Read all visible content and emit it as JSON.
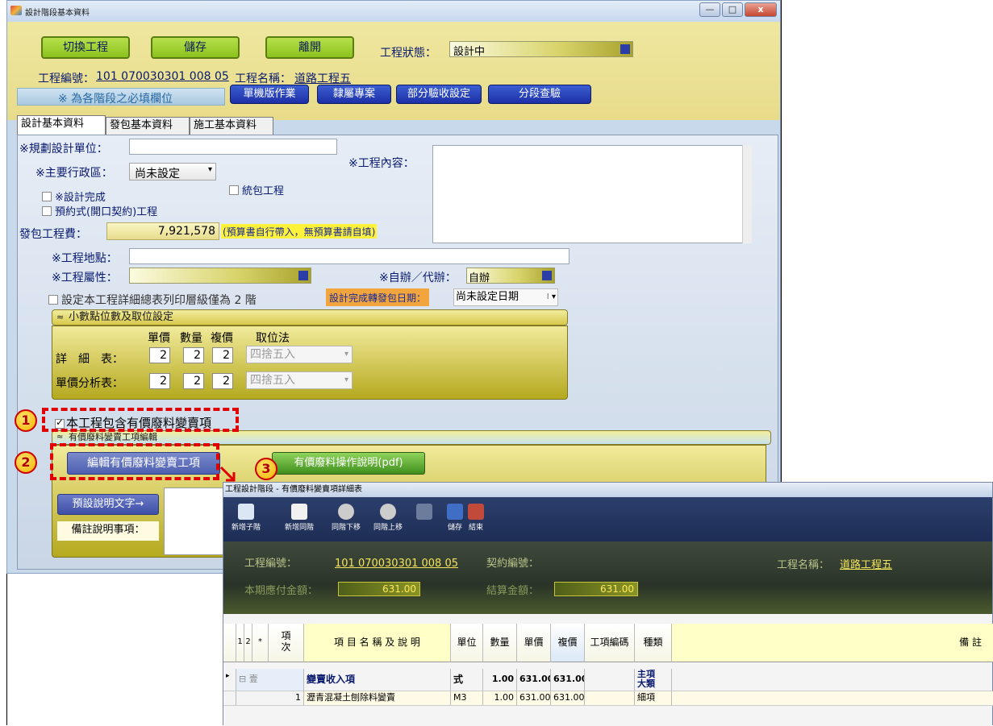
{
  "window1": {
    "title": "設計階段基本資料",
    "controls": [
      "—",
      "□",
      "x"
    ],
    "buttons": {
      "switch_project": "切換工程",
      "save": "儲存",
      "leave": "離開"
    },
    "project_status_label": "工程狀態：",
    "project_status_value": "設計中",
    "project_no_label": "工程編號：",
    "project_no_value": "101 070030301 008 05",
    "project_name_label": "工程名稱：",
    "project_name_value": "道路工程五",
    "required_note": "※ 為各階段之必填欄位",
    "blue_buttons": [
      "單機版作業",
      "隸屬專案",
      "部分驗收設定",
      "分段查驗"
    ],
    "tabs": [
      "設計基本資料",
      "發包基本資料",
      "施工基本資料"
    ],
    "form": {
      "planning_unit_label": "※規劃設計單位：",
      "admin_region_label": "※主要行政區：",
      "admin_region_value": "尚未設定",
      "design_complete_label": "※設計完成",
      "contract_type_label": "預約式(開口契約)工程",
      "package_label": "統包工程",
      "content_label": "※工程內容：",
      "contract_fee_label": "發包工程費：",
      "contract_fee_value": "7,921,578",
      "contract_fee_note": "(預算書自行帶入，無預算書請自填)",
      "location_label": "※工程地點：",
      "attribute_label": "※工程屬性：",
      "self_label": "※自辦／代辦：",
      "self_value": "自辦",
      "print_level_label": "設定本工程詳細總表列印層級僅為 2 階",
      "transfer_date_label": "設計完成轉發包日期：",
      "transfer_date_value": "尚未設定日期"
    },
    "decimal_section": {
      "title": "小數點位數及取位設定",
      "col_headers": [
        "單價",
        "數量",
        "複價",
        "取位法"
      ],
      "rows": [
        {
          "label": "詳　細　表：",
          "values": [
            "2",
            "2",
            "2"
          ],
          "method": "四捨五入"
        },
        {
          "label": "單價分析表：",
          "values": [
            "2",
            "2",
            "2"
          ],
          "method": "四捨五入"
        }
      ]
    },
    "scrap_checkbox_label": "本工程包含有價廢料變賣項",
    "scrap_section_title": "有價廢料變賣工項編輯",
    "edit_scrap_button": "編輯有價廢料變賣工項",
    "scrap_pdf_button": "有價廢料操作說明(pdf)",
    "default_text_button": "預設說明文字→",
    "remarks_label": "備註說明事項："
  },
  "badges": [
    "1",
    "2",
    "3"
  ],
  "window2": {
    "title": "工程設計階段 - 有價廢料變賣項詳細表",
    "toolbar": [
      "新增子階",
      "新增同階",
      "同階下移",
      "同階上移",
      "",
      "儲存",
      "結束"
    ],
    "info": {
      "project_no_label": "工程編號：",
      "project_no_value": "101 070030301 008 05",
      "contract_no_label": "契約編號：",
      "project_name_label": "工程名稱：",
      "project_name_value": "道路工程五",
      "payable_label": "本期應付金額：",
      "payable_value": "631.00",
      "settle_label": "結算金額：",
      "settle_value": "631.00"
    },
    "grid": {
      "headers": [
        "1",
        "2",
        "*",
        "項\n次",
        "項 目 名 稱 及 說 明",
        "單位",
        "數量",
        "單價",
        "複價",
        "工項編碼",
        "種類",
        "備 註"
      ],
      "rows": [
        {
          "no": "壹",
          "name": "變賣收入項",
          "unit": "式",
          "qty": "1.00",
          "price": "631.00",
          "total": "631.00",
          "code": "",
          "kind": "主項\n大類"
        },
        {
          "no": "1",
          "name": "瀝青混凝土刨除料變賣",
          "unit": "M3",
          "qty": "1.00",
          "price": "631.00",
          "total": "631.00",
          "code": "",
          "kind": "細項"
        }
      ]
    }
  },
  "colors": {
    "highlight_red": "#e00000",
    "badge_yellow": "#f0b400",
    "toolbar_blue": "#1d2d55"
  }
}
